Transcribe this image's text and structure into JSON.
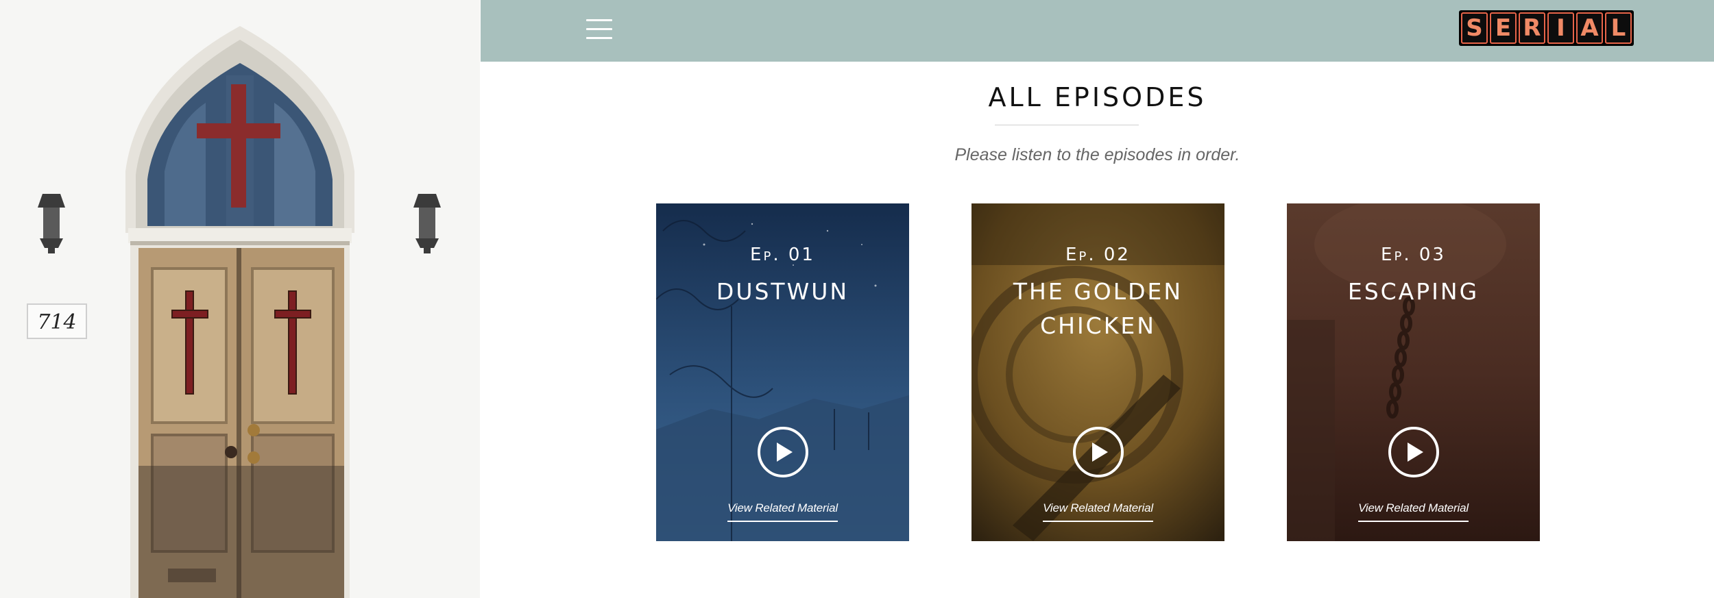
{
  "header": {
    "menu_icon": "hamburger-menu-icon",
    "logo_letters": [
      "S",
      "E",
      "R",
      "I",
      "A",
      "L"
    ],
    "background_color": "#a8c0bd"
  },
  "photo": {
    "house_number": "714",
    "description_icon": "church-door-image"
  },
  "main": {
    "title": "ALL EPISODES",
    "subtitle": "Please listen to the episodes in order."
  },
  "episodes": [
    {
      "number": "Ep. 01",
      "title": "DUSTWUN",
      "link": "View Related Material",
      "play_icon": "play-icon",
      "tint": "#2b4d72"
    },
    {
      "number": "Ep. 02",
      "title": "THE GOLDEN CHICKEN",
      "link": "View Related Material",
      "play_icon": "play-icon",
      "tint": "#7a5a22"
    },
    {
      "number": "Ep. 03",
      "title": "ESCAPING",
      "link": "View Related Material",
      "play_icon": "play-icon",
      "tint": "#4a2a22"
    }
  ]
}
